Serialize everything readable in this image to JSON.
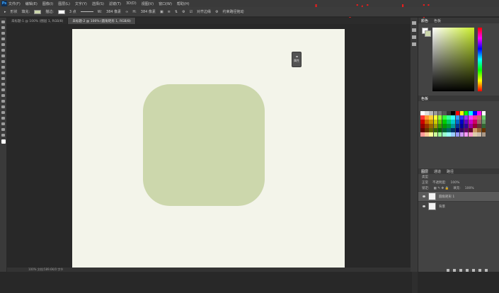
{
  "watermark": "www.haoyitianshoji.com",
  "menu": [
    "文件(F)",
    "编辑(E)",
    "图像(I)",
    "图层(L)",
    "文字(Y)",
    "选择(S)",
    "滤镜(T)",
    "3D(D)",
    "视图(V)",
    "窗口(W)",
    "帮助(H)"
  ],
  "options": {
    "mode": "形状",
    "fill_label": "填充:",
    "stroke_label": "描边:",
    "stroke_size": "3 点",
    "w_label": "W:",
    "w_value": "384 像素",
    "h_label": "H:",
    "h_value": "384 像素",
    "align_edges": "对齐边缘",
    "constrain": "约束路径拖动"
  },
  "tabs": [
    {
      "label": "未标题-1 @ 100% (图层 1, RGB/8)",
      "active": false
    },
    {
      "label": "未标题-2 @ 100% (圆角矩形 1, RGB/8)",
      "active": true
    }
  ],
  "mini_panel": {
    "label": "属性"
  },
  "status": {
    "text": "100%    文档:589.6K/0 字节"
  },
  "panels": {
    "color_tabs": [
      "颜色",
      "色板"
    ],
    "swatch_tab": "色板",
    "layer_tabs": [
      "图层",
      "通道",
      "路径"
    ],
    "kind_label": "类型",
    "blend_mode": "正常",
    "opacity_label": "不透明度:",
    "opacity_value": "100%",
    "lock_label": "锁定:",
    "fill_label": "填充:",
    "fill_value": "100%",
    "layers": [
      {
        "name": "圆角矩形 1",
        "selected": true
      },
      {
        "name": "背景",
        "selected": false
      }
    ]
  },
  "colors": {
    "canvas": "#f3f4ea",
    "shape": "#ccd7ac",
    "watermark": "#e81d1d"
  }
}
